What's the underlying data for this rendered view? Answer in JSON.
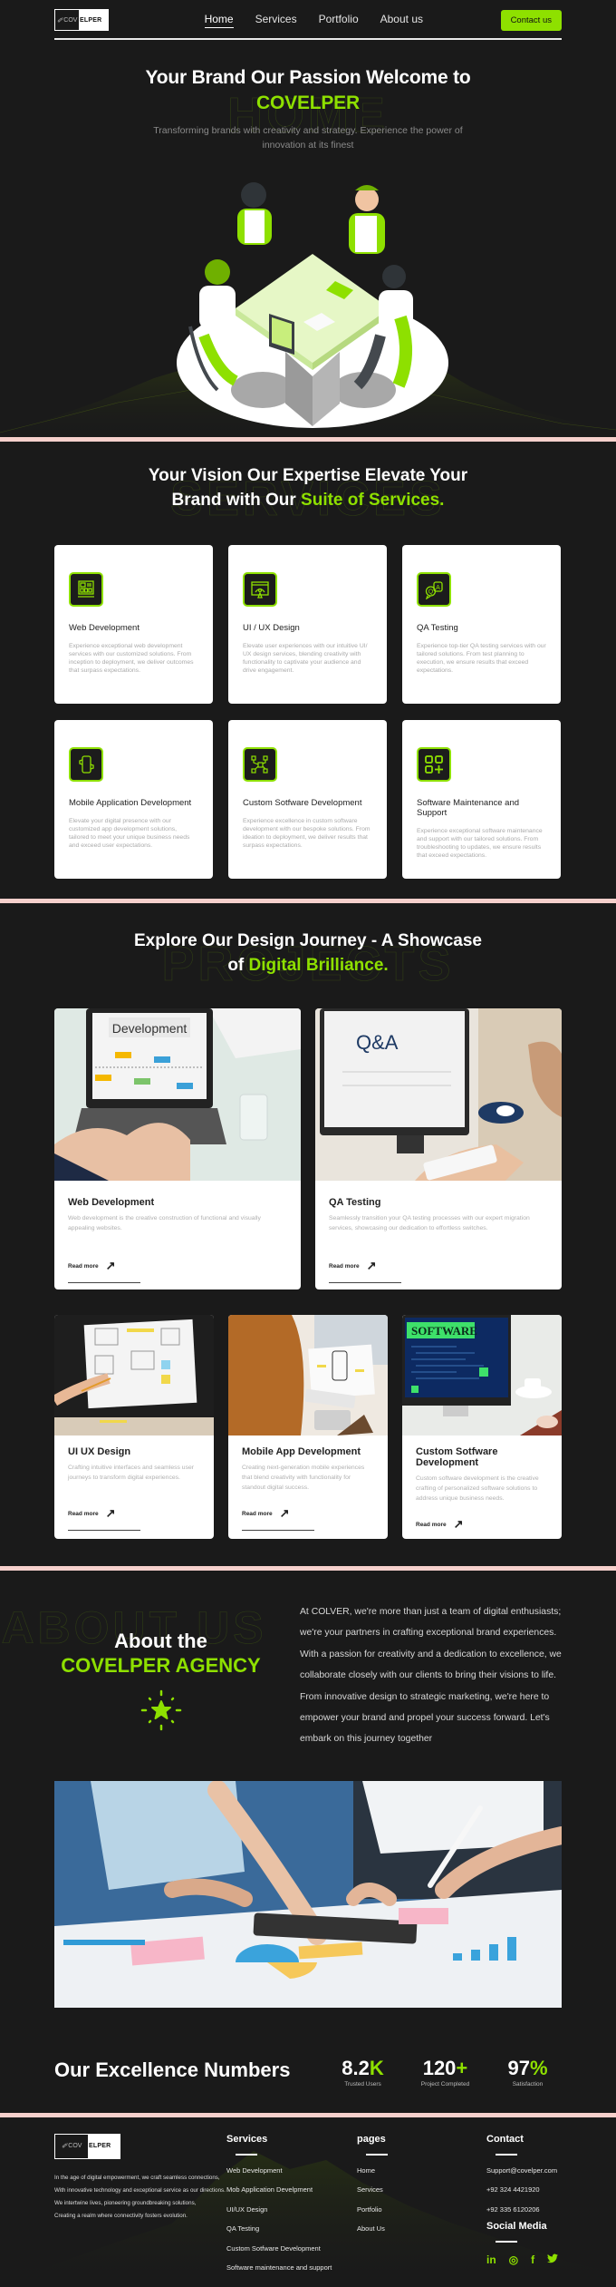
{
  "brand": {
    "logo_left": "COV",
    "logo_right": "ELPER",
    "accent_color": "#8ee000",
    "bg_color": "#1a1a1a",
    "divider_color": "#f6d0cc"
  },
  "nav": {
    "links": [
      "Home",
      "Services",
      "Portfolio",
      "About us"
    ],
    "active": "Home",
    "contact_button": "Contact us"
  },
  "hero": {
    "title_line1": "Your Brand Our Passion Welcome to",
    "title_accent": "COVELPER",
    "ghost_word": "HOME",
    "subtitle": "Transforming brands with creativity and strategy. Experience the power of innovation at its finest",
    "illustration": "team-meeting-illustration"
  },
  "services": {
    "ghost_word": "SERVICES",
    "title_line1": "Your Vision Our Expertise Elevate Your",
    "title_line2_plain": "Brand with Our ",
    "title_line2_accent": "Suite of Services.",
    "cards": [
      {
        "icon": "web-layout-icon",
        "title": "Web Development",
        "desc": "Experience exceptional web development services with our customized solutions. From inception to deployment, we deliver outcomes that surpass expectations."
      },
      {
        "icon": "design-pen-icon",
        "title": "UI / UX Design",
        "desc": "Elevate user experiences with our intuitive UI/ UX design services, blending creativity with functionality to captivate your audience and drive engagement."
      },
      {
        "icon": "qa-chat-icon",
        "title": "QA Testing",
        "desc": "Experience top-tier QA testing services with our tailored solutions. From test planning to execution, we ensure results that exceed expectations."
      },
      {
        "icon": "mobile-gear-icon",
        "title": "Mobile Application Development",
        "desc": "Elevate your digital presence with our customized app development solutions, tailored to meet your unique business needs and exceed user expectations."
      },
      {
        "icon": "circuit-icon",
        "title": "Custom Sotfware Development",
        "desc": "Experience excellence in custom software development with our bespoke solutions. From ideation to deployment, we deliver results that surpass expectations."
      },
      {
        "icon": "apps-plus-icon",
        "title": "Software Maintenance and Support",
        "desc": "Experience exceptional software maintenance and support with our tailored solutions. From troubleshooting to updates, we ensure results that exceed expectations."
      }
    ]
  },
  "projects": {
    "ghost_word": "PROJECTS",
    "title_line1": "Explore Our Design Journey - A Showcase",
    "title_line2_plain": "of ",
    "title_line2_accent": "Digital Brilliance.",
    "read_more": "Read more",
    "items": [
      {
        "title": "Web Development",
        "desc": "Web development is the creative construction of functional and visually appealing websites.",
        "image_text": "Development"
      },
      {
        "title": "QA Testing",
        "desc": "Seamlessly transition your QA testing processes with our expert migration services, showcasing our dedication to effortless switches.",
        "image_text": "Q&A"
      },
      {
        "title": "UI UX Design",
        "desc": "Crafting intuitive interfaces and seamless user journeys to transform digital experiences.",
        "image_text": ""
      },
      {
        "title": "Mobile App Development",
        "desc": "Creating next-generation mobile experiences that blend creativity with functionality for standout digital success.",
        "image_text": ""
      },
      {
        "title": "Custom Sotfware Development",
        "desc": "Custom software development is the creative crafting of personalized software solutions to address unique business needs.",
        "image_text": "SOFTWARE"
      }
    ]
  },
  "about": {
    "ghost_word": "ABOUT US",
    "title_line1": "About the",
    "title_accent": "COVELPER AGENCY",
    "body": "At COLVER, we're more than just a team of digital enthusiasts; we're your partners in crafting exceptional brand experiences. With a passion for creativity and a dedication to excellence, we collaborate closely with our clients to bring their visions to life. From innovative design to strategic marketing, we're here to empower your brand and propel your success forward. Let's embark on this journey together"
  },
  "numbers": {
    "title": "Our Excellence Numbers",
    "stats": [
      {
        "value": "8.2",
        "suffix": "K",
        "label": "Trusted Users"
      },
      {
        "value": "120",
        "suffix": "+",
        "label": "Project Completed"
      },
      {
        "value": "97",
        "suffix": "%",
        "label": "Satisfaction"
      }
    ]
  },
  "footer": {
    "about_lines": [
      "In the age of digital empowerment, we craft seamless connections,",
      "With innovative technology and exceptional service as our directions.",
      "We intertwine lives, pioneering groundbreaking solutions,",
      "Creating a realm where connectivity fosters evolution."
    ],
    "services_title": "Services",
    "services": [
      "Web Development",
      "Mob Application Develpment",
      "UI/UX Design",
      "QA Testing",
      "Custom Sotfware Development",
      "Software maintenance and support"
    ],
    "pages_title": "pages",
    "pages": [
      "Home",
      "Services",
      "Portfolio",
      "About Us"
    ],
    "contact_title": "Contact",
    "contact": [
      "Support@covelper.com",
      "+92 324 4421920",
      "+92 335 6120206"
    ],
    "social_title": "Social Media",
    "socials": [
      {
        "name": "linkedin",
        "glyph": "in"
      },
      {
        "name": "instagram",
        "glyph": "◎"
      },
      {
        "name": "facebook",
        "glyph": "f"
      },
      {
        "name": "twitter",
        "glyph": "🐦︎"
      }
    ]
  }
}
